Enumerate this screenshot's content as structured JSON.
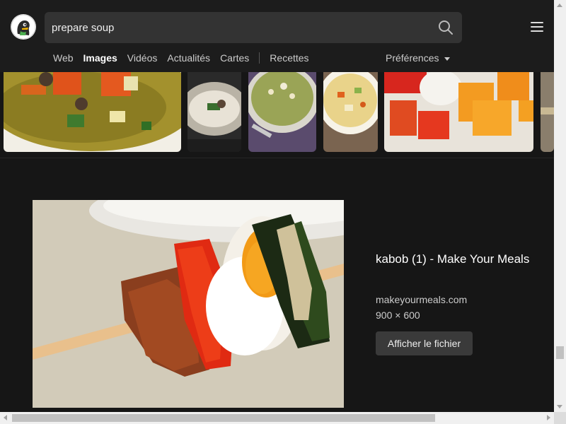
{
  "search": {
    "query": "prepare soup"
  },
  "nav": {
    "items": [
      "Web",
      "Images",
      "Vidéos",
      "Actualités",
      "Cartes",
      "Recettes"
    ],
    "active": "Images",
    "preferences_label": "Préférences"
  },
  "icons": {
    "logo": "duckduckgo-logo",
    "search": "search-icon",
    "menu": "hamburger-menu-icon",
    "prefs_caret": "caret-down-icon"
  },
  "detail": {
    "title": "kabob (1) - Make Your Meals",
    "source": "makeyourmeals.com",
    "dimensions": "900 × 600",
    "view_button": "Afficher le fichier"
  },
  "colors": {
    "background": "#161616",
    "header": "#1c1c1c",
    "search_box": "#333333",
    "button": "#3a3a3a"
  }
}
